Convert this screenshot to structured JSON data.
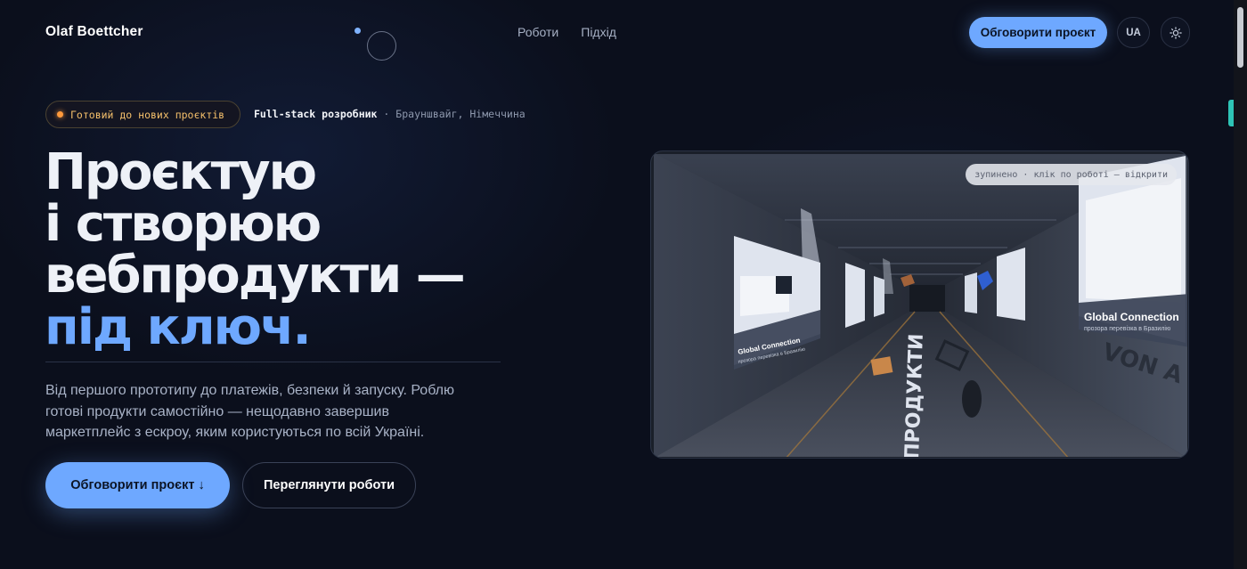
{
  "header": {
    "logo": "Olaf Boettcher",
    "nav": [
      "Роботи",
      "Підхід"
    ],
    "cta_label": "Обговорити проєкт",
    "lang_label": "UA",
    "theme_icon": "sun-icon"
  },
  "hero": {
    "badge": "Готовий до нових проєктів",
    "role": "Full-stack розробник",
    "role_separator": "·",
    "location": "Брауншвайг, Німеччина",
    "headline_line1": "Проєктую",
    "headline_line2": "і створюю",
    "headline_line3": "вебпродукти —",
    "headline_accent": "під ключ.",
    "lead": "Від першого прототипу до платежів, безпеки й запуску. Роблю готові продукти самостійно — нещодавно завершив маркетплейс з ескроу, яким користуються по всій Україні.",
    "primary_button": "Обговорити проєкт ↓",
    "secondary_button": "Переглянути роботи"
  },
  "scene": {
    "status_tag": "зупинено · клік по роботі — відкрити",
    "floor_text": "ПРОДУКТИ",
    "left_panel_title": "Global Connection",
    "left_panel_subtitle": "прозора перевізка в Бразилію",
    "right_panel_title": "Global Connection",
    "right_panel_subtitle": "прозора перевізка в Бразилію",
    "wall_text": "VON A B"
  },
  "colors": {
    "background": "#0b0f1c",
    "accent": "#6ea8ff",
    "badge_text": "#f5c06b",
    "badge_dot": "#ff9a3c"
  }
}
